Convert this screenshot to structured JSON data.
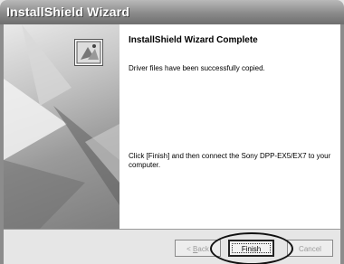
{
  "window": {
    "title": "InstallShield Wizard"
  },
  "icons": {
    "wizard": "installshield-wizard-icon"
  },
  "main": {
    "heading": "InstallShield Wizard Complete",
    "message_copied": "Driver files have been successfully copied.",
    "message_instruction": "Click [Finish] and then connect the Sony DPP-EX5/EX7 to your computer."
  },
  "buttons": {
    "back_prefix": "< ",
    "back_mnemonic": "B",
    "back_rest": "ack",
    "finish": "Finish",
    "cancel": "Cancel"
  }
}
